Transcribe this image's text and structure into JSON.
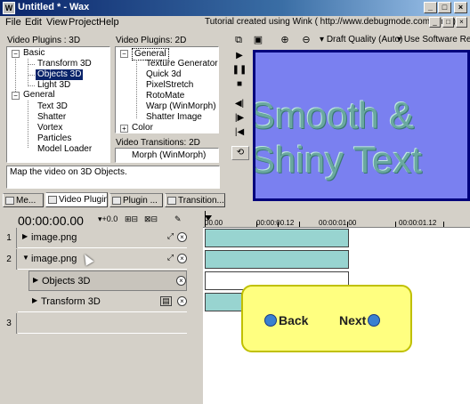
{
  "window": {
    "title": "Untitled * - Wax",
    "tutorial_text": "Tutorial created using Wink ( http://www.debugmode.com/wink )"
  },
  "menu": [
    "File",
    "Edit",
    "View",
    "Project",
    "Help"
  ],
  "plugins": {
    "video3d_label": "Video Plugins : 3D",
    "video2d_label": "Video Plugins: 2D",
    "transitions_label": "Video Transitions: 2D",
    "tree3d": {
      "basic": "Basic",
      "basic_items": [
        "Transform 3D",
        "Objects 3D",
        "Light 3D"
      ],
      "general": "General",
      "general_items": [
        "Text 3D",
        "Shatter",
        "Vortex",
        "Particles",
        "Model Loader"
      ]
    },
    "tree2d": {
      "general": "General",
      "general_items": [
        "Texture Generator",
        "Quick 3d",
        "PixelStretch",
        "RotoMate",
        "Warp (WinMorph)",
        "Shatter Image"
      ],
      "color": "Color"
    },
    "transitions": [
      "Morph (WinMorph)"
    ],
    "description": "Map the video on 3D Objects."
  },
  "tabs": [
    "Me...",
    "Video Plugins",
    "Plugin ...",
    "Transition..."
  ],
  "preview": {
    "quality": "Draft Quality (Auto)",
    "renderer": "Use Software Re",
    "text_line1": "Smooth &",
    "text_line2": "Shiny Text"
  },
  "timeline": {
    "timecode": "00:00:00.00",
    "btn1": "+0.0",
    "ruler": [
      "00.00",
      "00:00:00.12",
      "00:00:01.00",
      "00:00:01.12"
    ],
    "tracks": [
      {
        "num": "1",
        "label": "image.png"
      },
      {
        "num": "2",
        "label": "image.png"
      },
      {
        "num": "",
        "label": "Objects 3D"
      },
      {
        "num": "",
        "label": "Transform 3D"
      },
      {
        "num": "3",
        "label": ""
      }
    ]
  },
  "callout": {
    "back": "Back",
    "next": "Next"
  }
}
